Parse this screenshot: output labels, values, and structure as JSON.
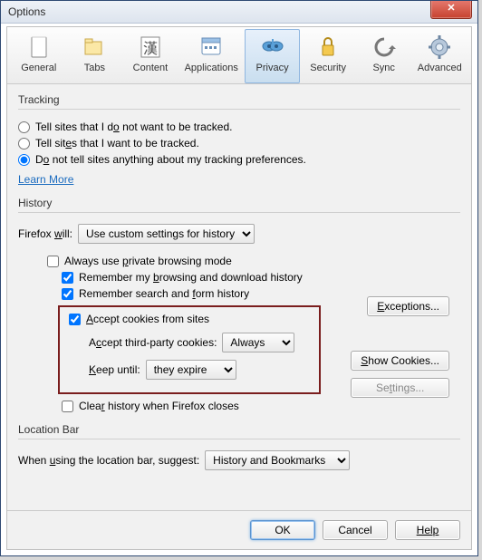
{
  "window": {
    "title": "Options"
  },
  "tabs": [
    {
      "id": "general",
      "label": "General"
    },
    {
      "id": "tabs",
      "label": "Tabs"
    },
    {
      "id": "content",
      "label": "Content"
    },
    {
      "id": "applications",
      "label": "Applications"
    },
    {
      "id": "privacy",
      "label": "Privacy",
      "selected": true
    },
    {
      "id": "security",
      "label": "Security"
    },
    {
      "id": "sync",
      "label": "Sync"
    },
    {
      "id": "advanced",
      "label": "Advanced"
    }
  ],
  "tracking": {
    "title": "Tracking",
    "options": {
      "dnt_on": "Tell sites that I do not want to be tracked.",
      "dnt_off": "Tell sites that I want to be tracked.",
      "dnt_no": "Do not tell sites anything about my tracking preferences."
    },
    "selected": "dnt_no",
    "learn_more": "Learn More"
  },
  "history": {
    "title": "History",
    "will_label_pre": "Firefox ",
    "will_label_post": ":",
    "will_underline": "w",
    "will_label_mid": "ill",
    "will_value": "Use custom settings for history",
    "private_label": "Always use private browsing mode",
    "private_checked": false,
    "remember_browsing": "Remember my browsing and download history",
    "remember_browsing_checked": true,
    "remember_form": "Remember search and form history",
    "remember_form_checked": true,
    "accept_cookies": "Accept cookies from sites",
    "accept_cookies_checked": true,
    "third_party_label": "Accept third-party cookies:",
    "third_party_value": "Always",
    "keep_label": "Keep until:",
    "keep_value": "they expire",
    "clear_on_close": "Clear history when Firefox closes",
    "clear_on_close_checked": false,
    "exceptions_btn": "Exceptions...",
    "show_cookies_btn": "Show Cookies...",
    "settings_btn": "Settings..."
  },
  "location_bar": {
    "title": "Location Bar",
    "label": "When using the location bar, suggest:",
    "value": "History and Bookmarks"
  },
  "footer": {
    "ok": "OK",
    "cancel": "Cancel",
    "help": "Help"
  }
}
